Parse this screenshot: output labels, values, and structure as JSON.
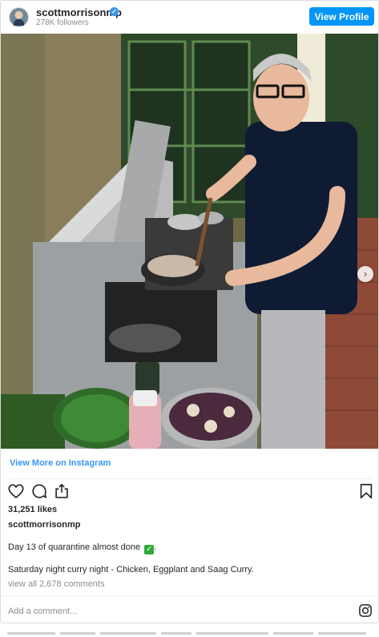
{
  "post": {
    "username": "scottmorrisonmp",
    "verified_mark": "✓",
    "followers": "278K followers",
    "view_profile_label": "View Profile",
    "view_more_label": "View More on Instagram",
    "likes": "31,251 likes",
    "caption_username": "scottmorrisonmp",
    "caption_line1": "Day 13 of quarantine almost done",
    "caption_emoji": "✓",
    "caption_line2_tail": ".",
    "caption_line3": "Saturday night curry night - Chicken, Eggplant and Saag Curry.",
    "view_comments": "view all 2,678 comments",
    "add_comment_placeholder": "Add a comment...",
    "next_arrow": "›"
  },
  "colors": {
    "accent": "#0095f6",
    "link": "#3897f0",
    "muted": "#8e8e8e",
    "text": "#262626",
    "check_emoji_bg": "#2eaa36"
  },
  "icons": [
    "avatar",
    "verified-badge-icon",
    "heart-icon",
    "comment-icon",
    "share-icon",
    "bookmark-icon",
    "instagram-icon",
    "chevron-right-icon"
  ]
}
